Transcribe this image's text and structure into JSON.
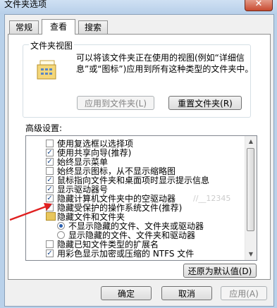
{
  "window": {
    "title": "文件夹选项",
    "close_glyph": "✕"
  },
  "tabs": [
    {
      "label": "常规"
    },
    {
      "label": "查看"
    },
    {
      "label": "搜索"
    }
  ],
  "folder_views": {
    "title": "文件夹视图",
    "description": "可以将该文件夹正在使用的视图(例如“详细信息”或“图标”)应用到所有这种类型的文件夹中。",
    "apply_button": "应用到文件夹(L)",
    "reset_button": "重置文件夹(R)"
  },
  "advanced": {
    "label": "高级设置:",
    "items": [
      {
        "type": "checkbox",
        "checked": false,
        "label": "使用复选框以选择项"
      },
      {
        "type": "checkbox",
        "checked": true,
        "label": "使用共享向导(推荐)"
      },
      {
        "type": "checkbox",
        "checked": true,
        "label": "始终显示菜单"
      },
      {
        "type": "checkbox",
        "checked": false,
        "label": "始终显示图标，从不显示缩略图"
      },
      {
        "type": "checkbox",
        "checked": true,
        "label": "鼠标指向文件夹和桌面项时显示提示信息"
      },
      {
        "type": "checkbox",
        "checked": true,
        "label": "显示驱动器号"
      },
      {
        "type": "checkbox",
        "checked": true,
        "label": "隐藏计算机文件夹中的空驱动器"
      },
      {
        "type": "checkbox",
        "checked": true,
        "label": "隐藏受保护的操作系统文件(推荐)"
      },
      {
        "type": "folder",
        "label": "隐藏文件和文件夹"
      },
      {
        "type": "radio",
        "checked": true,
        "label": "不显示隐藏的文件、文件夹或驱动器"
      },
      {
        "type": "radio",
        "checked": false,
        "label": "显示隐藏的文件、文件夹和驱动器"
      },
      {
        "type": "checkbox",
        "checked": false,
        "label": "隐藏已知文件类型的扩展名"
      },
      {
        "type": "checkbox",
        "checked": true,
        "label": "用彩色显示加密或压缩的 NTFS 文件"
      }
    ],
    "restore_button": "还原为默认值(D)"
  },
  "footer": {
    "ok": "确定",
    "cancel": "取消",
    "apply": "应用(A)"
  },
  "watermark": "//__12345"
}
